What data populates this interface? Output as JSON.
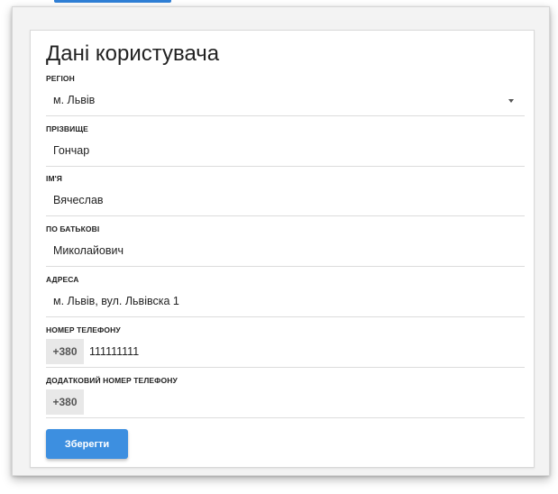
{
  "form": {
    "title": "Дані користувача",
    "fields": [
      {
        "label": "РЕГІОН",
        "value": "м. Львів"
      },
      {
        "label": "ПРІЗВИЩЕ",
        "value": "Гончар"
      },
      {
        "label": "ІМ'Я",
        "value": "Вячеслав"
      },
      {
        "label": "ПО БАТЬКОВІ",
        "value": "Миколайович"
      },
      {
        "label": "АДРЕСА",
        "value": "м. Львів, вул. Львівска 1"
      }
    ],
    "phone": {
      "label": "НОМЕР ТЕЛЕФОНУ",
      "prefix": "+380",
      "value": "111111111"
    },
    "extra_phone": {
      "label": "ДОДАТКОВИЙ НОМЕР ТЕЛЕФОНУ",
      "prefix": "+380",
      "value": ""
    },
    "save_label": "Зберегти"
  },
  "colors": {
    "accent": "#3d8fe0",
    "prefix_bg": "#e8e8e8"
  },
  "icons": {
    "region_dropdown": "caret-down-icon"
  }
}
